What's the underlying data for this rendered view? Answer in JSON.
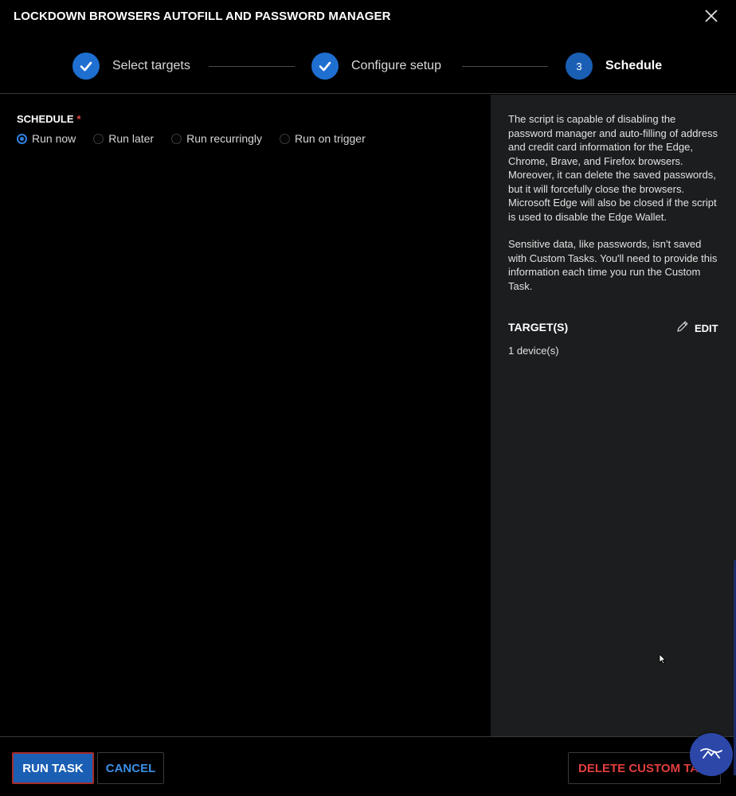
{
  "header": {
    "title": "LOCKDOWN BROWSERS AUTOFILL AND PASSWORD MANAGER",
    "close_icon": "close-icon"
  },
  "stepper": {
    "steps": [
      {
        "label": "Select targets",
        "state": "done",
        "number": ""
      },
      {
        "label": "Configure setup",
        "state": "done",
        "number": ""
      },
      {
        "label": "Schedule",
        "state": "current",
        "number": "3"
      }
    ]
  },
  "schedule": {
    "label": "SCHEDULE",
    "required_mark": "*",
    "options": [
      {
        "label": "Run now",
        "checked": true
      },
      {
        "label": "Run later",
        "checked": false
      },
      {
        "label": "Run recurringly",
        "checked": false
      },
      {
        "label": "Run on trigger",
        "checked": false
      }
    ]
  },
  "side": {
    "description_1": "The script is capable of disabling the password manager and auto-filling of address and credit card information for the Edge, Chrome, Brave, and Firefox browsers. Moreover, it can delete the saved passwords, but it will forcefully close the browsers. Microsoft Edge will also be closed if the script is used to disable the Edge Wallet.",
    "description_2": "Sensitive data, like passwords, isn't saved with Custom Tasks. You'll need to provide this information each time you run the Custom Task.",
    "targets_heading": "TARGET(S)",
    "edit_label": "EDIT",
    "targets_count": "1 device(s)"
  },
  "footer": {
    "run_label": "RUN TASK",
    "cancel_label": "CANCEL",
    "delete_label": "DELETE CUSTOM TASK"
  },
  "colors": {
    "accent": "#1a5fb4",
    "link": "#3d8fe6",
    "danger": "#e33e3e",
    "side_panel": "#1b1d1e"
  }
}
